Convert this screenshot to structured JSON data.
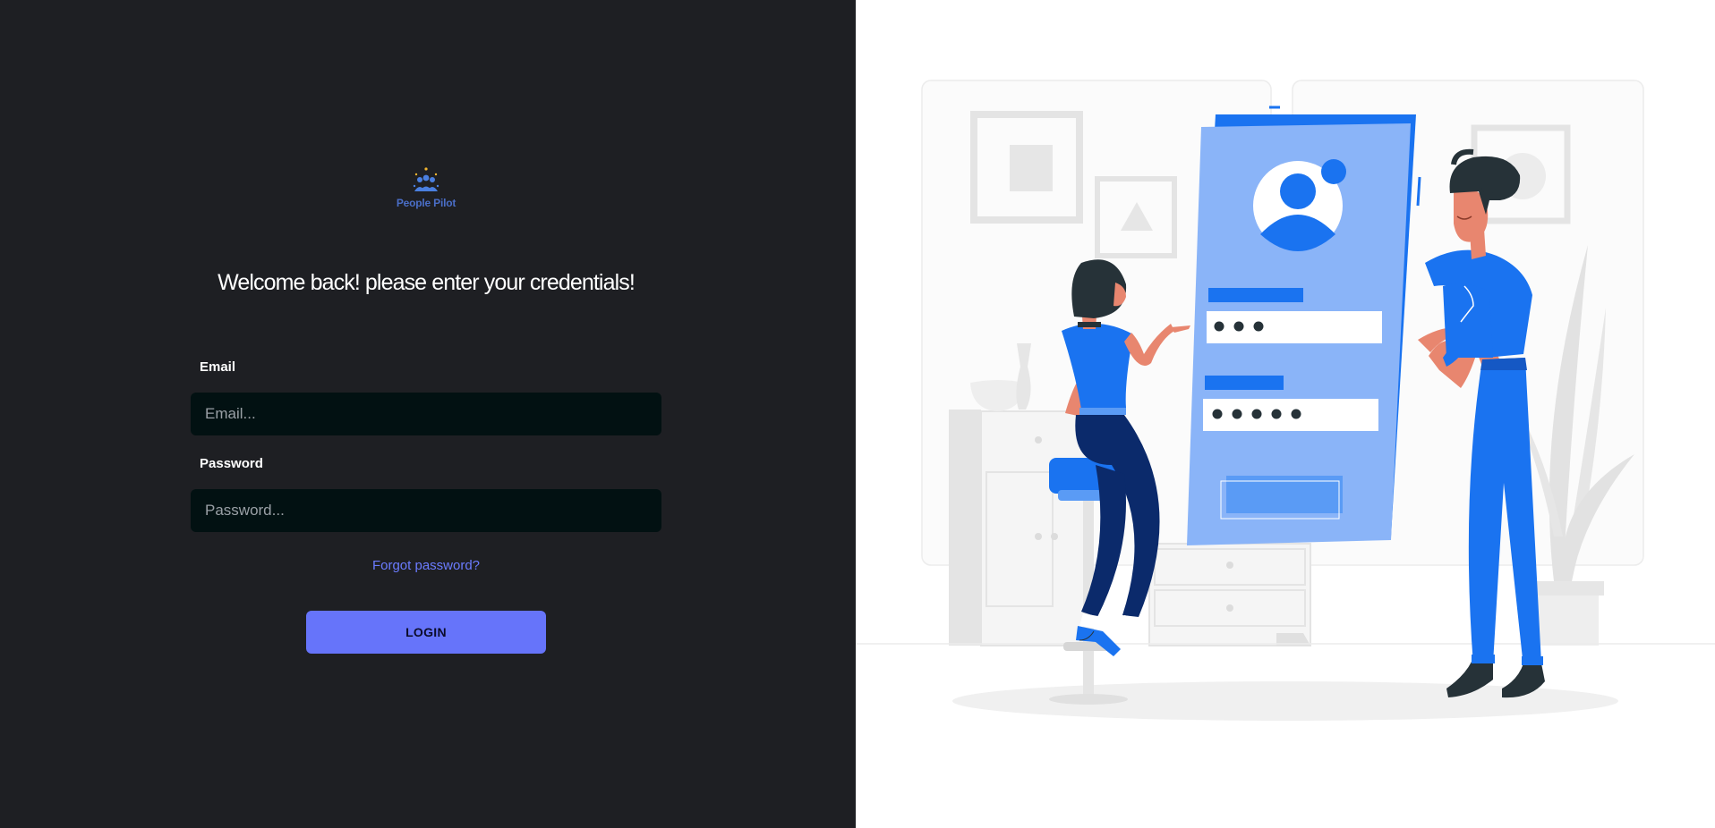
{
  "brand": {
    "name": "People Pilot",
    "icon": "people-group-icon",
    "color": "#4a6ec7"
  },
  "heading": "Welcome back! please enter your credentials!",
  "form": {
    "email_label": "Email",
    "email_placeholder": "Email...",
    "password_label": "Password",
    "password_placeholder": "Password...",
    "forgot_label": "Forgot password?",
    "login_label": "LOGIN"
  },
  "illustration": {
    "subject": "login-illustration"
  },
  "colors": {
    "left_bg": "#1e1f23",
    "input_bg": "#021112",
    "accent": "#6674fa",
    "link": "#6b7cff",
    "illustration_blue": "#1a73f0"
  }
}
